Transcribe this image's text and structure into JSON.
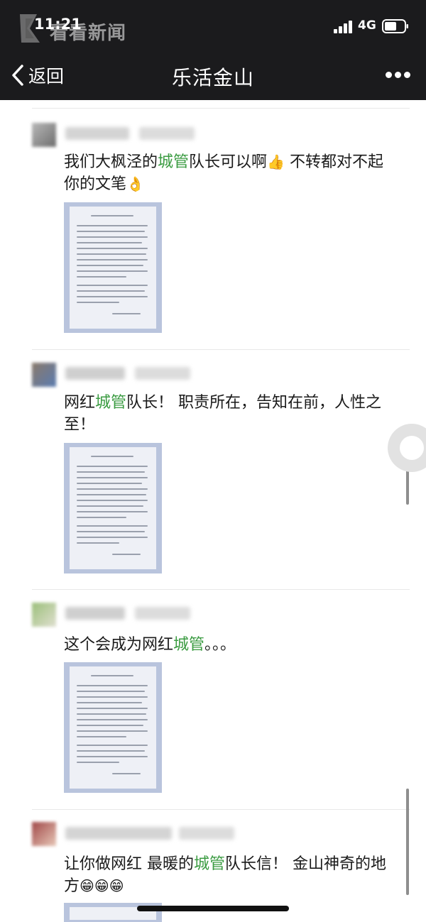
{
  "status_bar": {
    "time": "11:21",
    "network": "4G",
    "watermark": "看看新闻"
  },
  "nav": {
    "back_label": "返回",
    "title": "乐活金山"
  },
  "colors": {
    "keyword_green": "#3a9b41",
    "topbar": "#1b1b1d"
  },
  "comments": [
    {
      "before": "我们大枫泾的",
      "keyword": "城管",
      "after": "队长可以啊",
      "emoji1": "👍",
      "after2": " 不转都对不起你的文笔",
      "emoji2": "👌"
    },
    {
      "before": "网红",
      "keyword": "城管",
      "after": "队长！ 职责所在，告知在前，人性之至！"
    },
    {
      "before": "这个会成为网红",
      "keyword": "城管",
      "after": "。。。"
    },
    {
      "before": "让你做网红 最暖的",
      "keyword": "城管",
      "after": "队长信！ 金山神奇的地方",
      "emoji": "😁😁😁"
    }
  ]
}
